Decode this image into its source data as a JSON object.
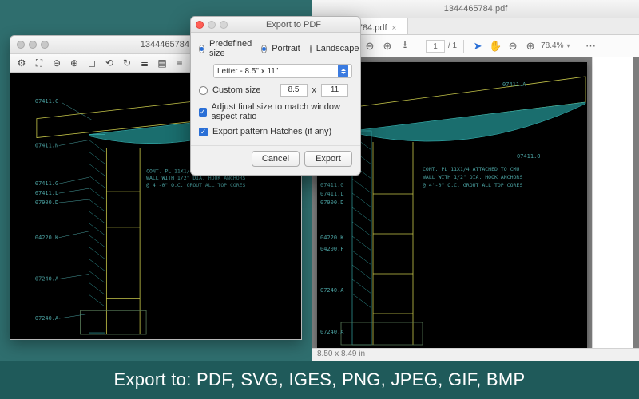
{
  "caption": "Export to: PDF, SVG, IGES, PNG, JPEG, GIF, BMP",
  "cad": {
    "title": "1344465784.dwg",
    "toolbar_icons": [
      "gear",
      "fit-extents",
      "zoom-out",
      "zoom-in",
      "zoom-window",
      "pan",
      "rotate",
      "layers",
      "measure",
      "redraw"
    ],
    "labels": {
      "l1": "07411.C",
      "l2": "07411.N",
      "l3": "07411.G",
      "l4": "07411.L",
      "l5": "07900.D",
      "l6": "04220.K",
      "l7": "07240.A",
      "l8": "07240.A",
      "r1": "07411.A",
      "r2": "07411.O",
      "r3": "04200.F"
    },
    "note1": "CONT. PL 11X1/4 ATTACHED TO CMU",
    "note2": "WALL WITH 1/2\" DIA. HOOK ANCHORS",
    "note3": "@ 4'-0\" O.C. GROUT ALL TOP CORES"
  },
  "pdf": {
    "title": "1344465784.pdf",
    "tab_label": "1344465784.pdf",
    "page_current": "1",
    "page_total": "/ 1",
    "zoom": "78.4%",
    "status": "8.50 x 8.49 in",
    "labels": {
      "r1": "07411.A",
      "r2": "07411.O",
      "l3": "07411.G",
      "l4": "07411.L",
      "l5": "07900.D",
      "l6": "04220.K",
      "r3": "04200.F",
      "l7": "07240.A",
      "l8": "07240.A"
    },
    "note1": "CONT. PL 11X1/4 ATTACHED TO CMU",
    "note2": "WALL WITH 1/2\" DIA. HOOK ANCHORS",
    "note3": "@ 4'-0\" O.C. GROUT ALL TOP CORES"
  },
  "dialog": {
    "title": "Export to PDF",
    "predefined_label": "Predefined size",
    "custom_label": "Custom size",
    "portrait": "Portrait",
    "landscape": "Landscape",
    "paper_option": "Letter  -  8.5\" x 11\"",
    "width": "8.5",
    "x": "x",
    "height": "11",
    "aspect_label": "Adjust final size to match window aspect ratio",
    "hatch_label": "Export pattern Hatches (if any)",
    "cancel": "Cancel",
    "export": "Export"
  }
}
